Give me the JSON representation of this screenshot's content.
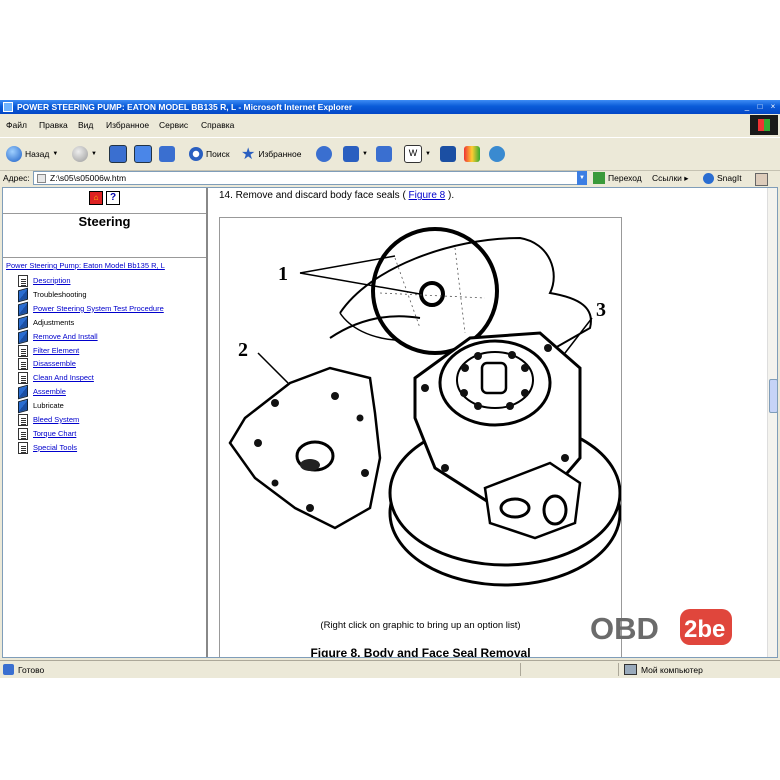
{
  "window": {
    "title": "POWER STEERING PUMP: EATON MODEL BB135 R, L - Microsoft Internet Explorer",
    "controls": [
      "_",
      "□",
      "×"
    ]
  },
  "menu": [
    "Файл",
    "Правка",
    "Вид",
    "Избранное",
    "Сервис",
    "Справка"
  ],
  "toolbar": {
    "back": "Назад",
    "search": "Поиск",
    "favorites": "Избранное"
  },
  "address": {
    "label": "Адрес:",
    "value": "Z:\\s05\\s05006w.htm",
    "go": "Переход",
    "links": "Ссылки",
    "snagit": "SnagIt"
  },
  "sidebar": {
    "home_icon": "home-icon",
    "help_label": "?",
    "title": "Steering",
    "root": "Power Steering Pump: Eaton Model Bb135 R, L",
    "items": [
      {
        "label": "Description",
        "icon": "page",
        "link": true
      },
      {
        "label": "Troubleshooting",
        "icon": "book",
        "link": false
      },
      {
        "label": "Power Steering System Test Procedure",
        "icon": "book",
        "link": true
      },
      {
        "label": "Adjustments",
        "icon": "book",
        "link": false
      },
      {
        "label": "Remove And Install",
        "icon": "book",
        "link": true
      },
      {
        "label": "Filter Element",
        "icon": "page",
        "link": true
      },
      {
        "label": "Disassemble",
        "icon": "page",
        "link": true
      },
      {
        "label": "Clean And Inspect",
        "icon": "page",
        "link": true
      },
      {
        "label": "Assemble",
        "icon": "book",
        "link": true
      },
      {
        "label": "Lubricate",
        "icon": "book",
        "link": false
      },
      {
        "label": "Bleed System",
        "icon": "page",
        "link": true
      },
      {
        "label": "Torque Chart",
        "icon": "page",
        "link": true
      },
      {
        "label": "Special Tools",
        "icon": "page",
        "link": true
      }
    ]
  },
  "main": {
    "step_text": "14. Remove and discard body face seals ( ",
    "step_link": "Figure 8",
    "step_end": " ).",
    "callouts": [
      "1",
      "2",
      "3"
    ],
    "caption": "(Right click on graphic to bring up an option list)",
    "figure_title": "Figure 8. Body and Face Seal Removal"
  },
  "status": {
    "left": "Готово",
    "right": "Мой компьютер"
  },
  "watermark": {
    "part1": "OBD",
    "part2": "2be"
  },
  "colors": {
    "titlebar": "#0a5bd8",
    "chrome": "#ece9d8",
    "link": "#0000cc",
    "watermark_red": "#e0463c"
  }
}
